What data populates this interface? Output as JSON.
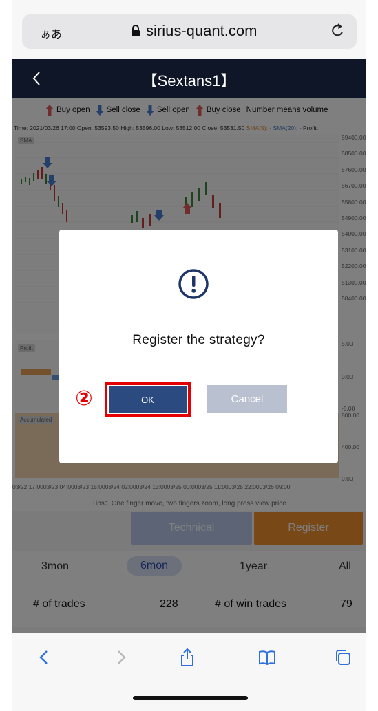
{
  "browser": {
    "aa_label": "ぁあ",
    "domain": "sirius-quant.com"
  },
  "app": {
    "title": "【Sextans1】"
  },
  "chart": {
    "legend": {
      "buy_open": "Buy open",
      "sell_close": "Sell close",
      "sell_open": "Sell open",
      "buy_close": "Buy close",
      "note": "Number means volume"
    },
    "info": {
      "time": "Time: 2021/03/26 17:00",
      "open": "Open: 53593.50",
      "high": "High: 53596.00",
      "low": "Low: 53512.00",
      "close": "Close: 53531.50",
      "sma5": "SMA(5): -",
      "sma20": "SMA(20): -",
      "profit": "Profit:"
    },
    "panel_tags": {
      "sma": "SMA",
      "profit": "Profit",
      "accumulated": "Accumulated"
    },
    "price_ticks": [
      "59400.00",
      "58500.00",
      "57600.00",
      "56700.00",
      "55800.00",
      "54900.00",
      "54000.00",
      "53100.00",
      "52200.00",
      "51300.00",
      "50400.00"
    ],
    "profit_ticks": [
      "5.00",
      "0.00",
      "-5.00"
    ],
    "acc_ticks": [
      "800.00",
      "400.00",
      "0.00"
    ],
    "time_axis": "03/22 17:0003/23 04:0003/23 15:0003/24 02:0003/24 13:0003/25 00:0003/25 11:0003/25 22:0003/26 09:00",
    "tips": "Tips：One finger move, two fingers zoom, long press view price"
  },
  "actions": {
    "technical": "Technical",
    "register": "Register"
  },
  "periods": [
    {
      "label": "3mon",
      "active": false
    },
    {
      "label": "6mon",
      "active": true
    },
    {
      "label": "1year",
      "active": false
    },
    {
      "label": "All",
      "active": false
    }
  ],
  "stats": {
    "trades_label": "# of trades",
    "trades_value": "228",
    "win_trades_label": "# of win trades",
    "win_trades_value": "79"
  },
  "modal": {
    "message": "Register  the  strategy?",
    "ok": "OK",
    "cancel": "Cancel",
    "step": "②"
  },
  "colors": {
    "nav_bg": "#0e1628",
    "ok_button": "#2b4a80",
    "cancel_button": "#b9c1d1",
    "highlight": "#e40000",
    "register_button": "#f0912d",
    "technical_button": "#b9c8ec",
    "buy_marker": "#e35a5a",
    "sell_marker": "#4a7fd6"
  }
}
